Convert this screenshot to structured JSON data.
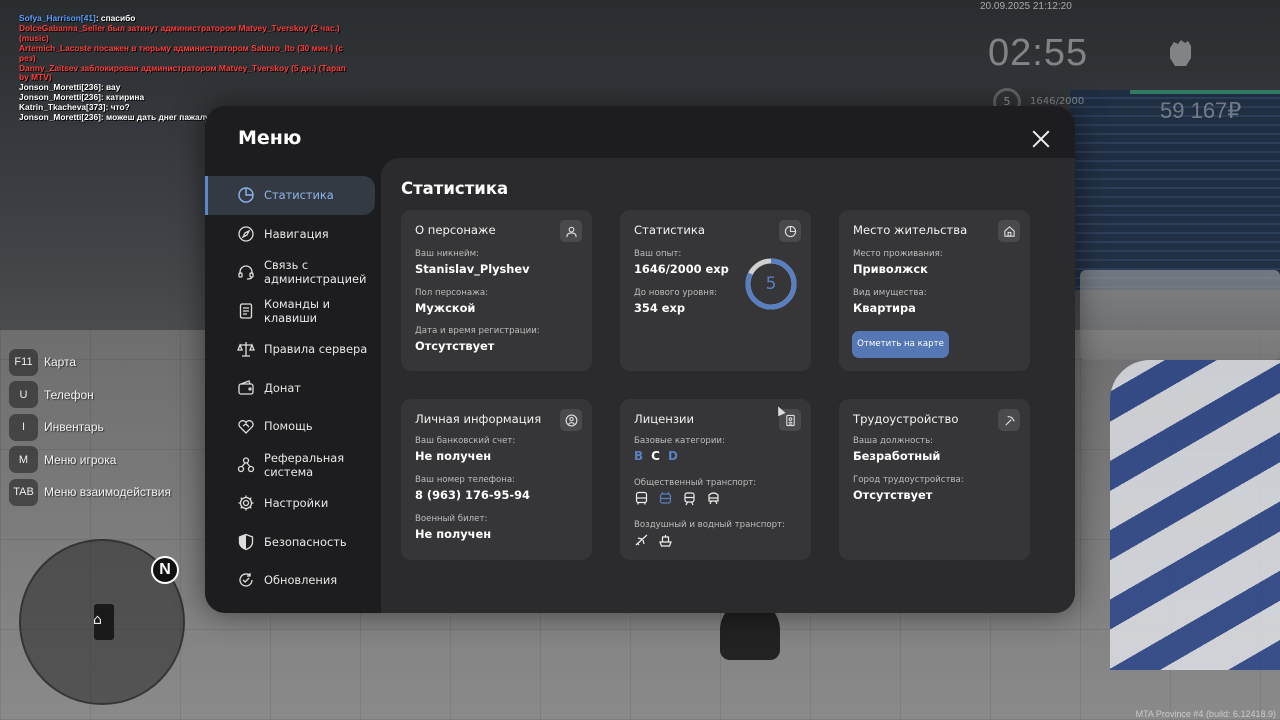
{
  "chat": [
    {
      "name": "Sofya_Harrison[41]",
      "text": ": спасибо",
      "color": "white"
    },
    {
      "name": "",
      "text": "DolceGabanna_Seller был заткнут администратором Matvey_Tverskoy (2 час.) (music)",
      "color": "red"
    },
    {
      "name": "",
      "text": "Artemich_Lacoste посажен в тюрьму администратором Saburo_Ito (30 мин.) (с рез)",
      "color": "red"
    },
    {
      "name": "",
      "text": "Danny_Zaitsev заблокирован администратором Matvey_Tverskoy (5 дн.) (Тарап by MTV)",
      "color": "red"
    },
    {
      "name": "",
      "text": "Jonson_Moretti[236]: вау",
      "color": "white"
    },
    {
      "name": "",
      "text": "Jonson_Moretti[236]: катирина",
      "color": "white"
    },
    {
      "name": "",
      "text": "Katrin_Tkacheva[373]: что?",
      "color": "white"
    },
    {
      "name": "",
      "text": "Jonson_Moretti[236]: можеш дать днег пажалуста",
      "color": "white"
    }
  ],
  "hud": {
    "datetime": "20.09.2025 21:12:20",
    "time": "02:55",
    "level": "5",
    "exp": "1646/2000",
    "money": "59 167₽"
  },
  "keybinds": [
    {
      "key": "F11",
      "label": "Карта"
    },
    {
      "key": "U",
      "label": "Телефон"
    },
    {
      "key": "I",
      "label": "Инвентарь"
    },
    {
      "key": "M",
      "label": "Меню игрока"
    },
    {
      "key": "TAB",
      "label": "Меню взаимодействия"
    }
  ],
  "minimap": {
    "north": "N"
  },
  "watermark": "MTA Province #4 (build: 6.12418.9)",
  "menu": {
    "title": "Меню",
    "sidebar": [
      {
        "label": "Статистика",
        "icon": "pie-chart-icon",
        "active": true
      },
      {
        "label": "Навигация",
        "icon": "compass-icon"
      },
      {
        "label": "Связь с администрацией",
        "icon": "headset-icon"
      },
      {
        "label": "Команды и клавиши",
        "icon": "document-icon"
      },
      {
        "label": "Правила сервера",
        "icon": "scales-icon"
      },
      {
        "label": "Донат",
        "icon": "wallet-icon"
      },
      {
        "label": "Помощь",
        "icon": "heart-handshake-icon"
      },
      {
        "label": "Реферальная система",
        "icon": "referral-icon"
      },
      {
        "label": "Настройки",
        "icon": "gear-icon"
      },
      {
        "label": "Безопасность",
        "icon": "shield-icon"
      },
      {
        "label": "Обновления",
        "icon": "refresh-check-icon"
      }
    ],
    "content_title": "Статистика",
    "cards": {
      "character": {
        "title": "О персонаже",
        "nickname_label": "Ваш никнейм:",
        "nickname": "Stanislav_Plyshev",
        "gender_label": "Пол персонажа:",
        "gender": "Мужской",
        "reg_label": "Дата и время регистрации:",
        "reg": "Отсутствует"
      },
      "stats": {
        "title": "Статистика",
        "exp_label": "Ваш опыт:",
        "exp": "1646/2000 exp",
        "next_label": "До нового уровня:",
        "next": "354 exp",
        "level": "5",
        "progress": 0.823
      },
      "residence": {
        "title": "Место жительства",
        "place_label": "Место проживания:",
        "place": "Приволжск",
        "property_label": "Вид имущества:",
        "property": "Квартира",
        "button": "Отметить на карте"
      },
      "personal": {
        "title": "Личная информация",
        "bank_label": "Ваш банковский счет:",
        "bank": "Не получен",
        "phone_label": "Ваш номер телефона:",
        "phone": "8 (963) 176-95-94",
        "military_label": "Военный билет:",
        "military": "Не получен"
      },
      "licenses": {
        "title": "Лицензии",
        "base_label": "Базовые категории:",
        "categories": [
          "B",
          "C",
          "D"
        ],
        "public_label": "Общественный транспорт:",
        "air_label": "Воздушный и водный транспорт:"
      },
      "employment": {
        "title": "Трудоустройство",
        "position_label": "Ваша должность:",
        "position": "Безработный",
        "city_label": "Город трудоустройства:",
        "city": "Отсутствует"
      }
    }
  },
  "colors": {
    "accent": "#5a7fc0",
    "button": "#5577b4",
    "panel": "#1d1d1f",
    "content": "#2b2b2d",
    "card": "#363638"
  }
}
